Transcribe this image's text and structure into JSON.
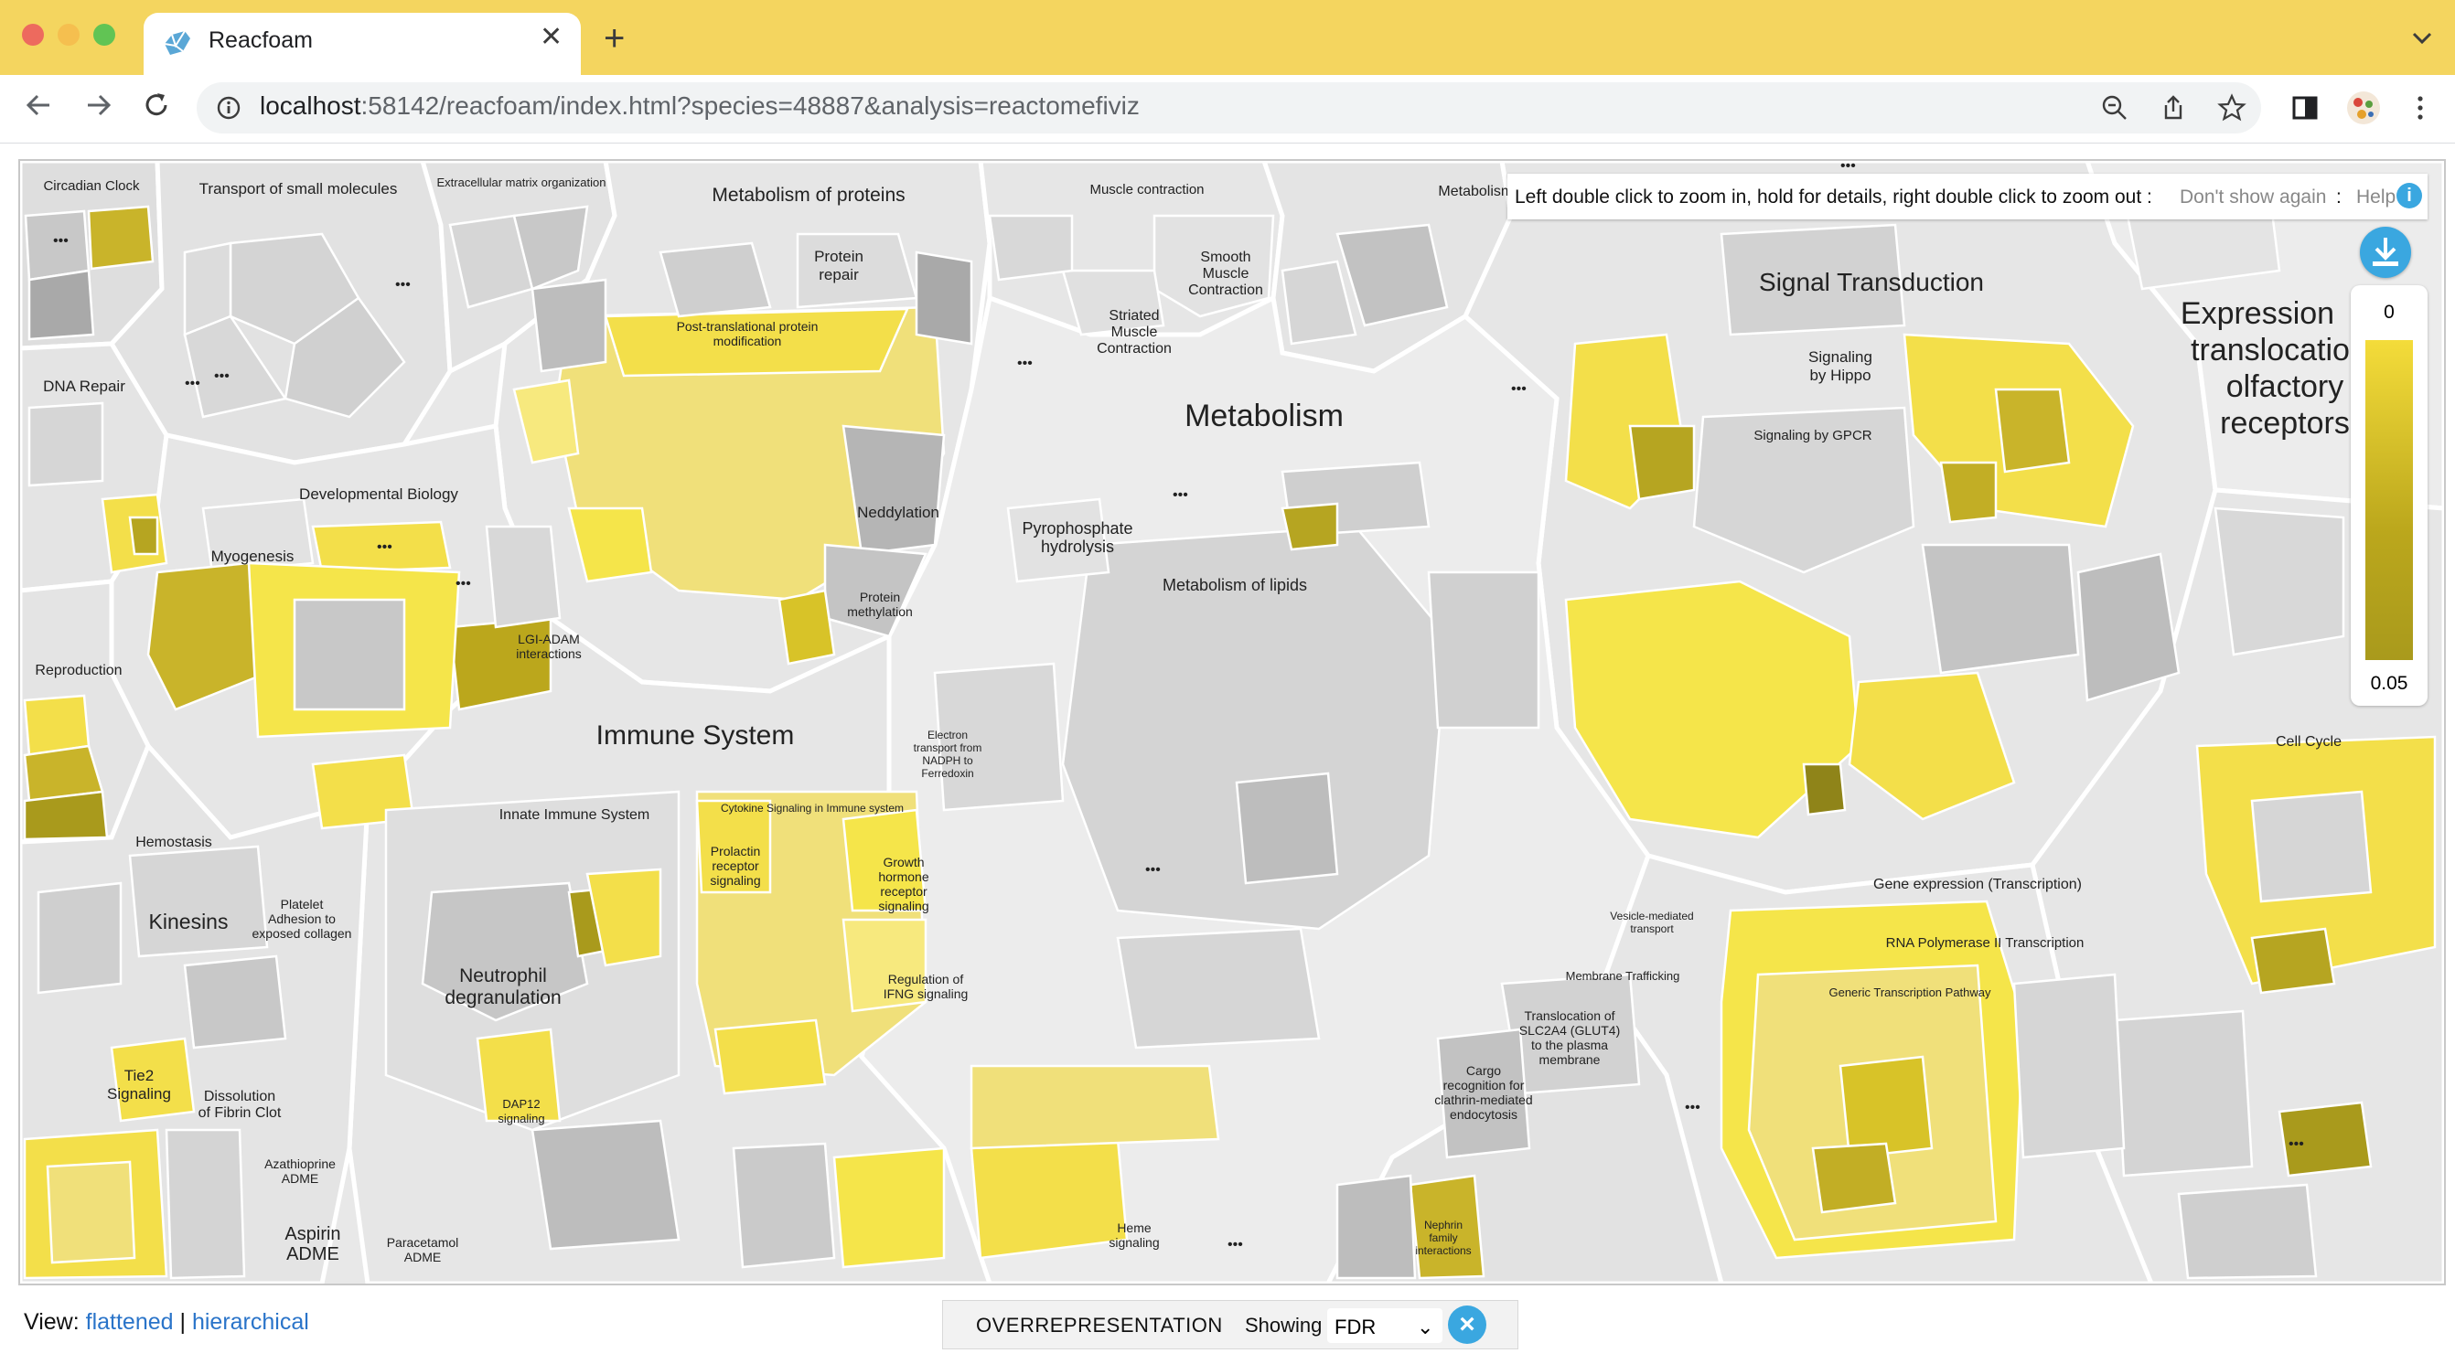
{
  "browser": {
    "tab_title": "Reacfoam",
    "url_host": "localhost",
    "url_rest": ":58142/reacfoam/index.html?species=48887&analysis=reactomefiviz",
    "tab_close": "✕",
    "new_tab": "+",
    "colors": {
      "tabbar": "#f4d55f",
      "omnibox": "#f1f3f4"
    }
  },
  "hint": {
    "text": "Left double click to zoom in, hold for details, right double click to zoom out :",
    "dismiss": "Don't show again",
    "separator": ":",
    "help": "Help",
    "help_icon": "i"
  },
  "legend": {
    "top": "0",
    "bottom": "0.05",
    "colors": [
      "#f4dc3a",
      "#a99a1c"
    ]
  },
  "regions": [
    {
      "name": "Circadian Clock",
      "color": "#e0e0e0"
    },
    {
      "name": "Transport of small molecules",
      "color": "#e0e0e0"
    },
    {
      "name": "Extracellular matrix organization",
      "color": "#e0e0e0"
    },
    {
      "name": "Metabolism of proteins",
      "color": "#e6e6e6"
    },
    {
      "name": "Muscle contraction",
      "color": "#e6e6e6"
    },
    {
      "name": "Metabolism o",
      "color": "#e6e6e6"
    },
    {
      "name": "Signal Transduction",
      "color": "#e6e6e6"
    },
    {
      "name": "Expression and translocation of olfactory receptors",
      "color": "#ececec"
    },
    {
      "name": "DNA Repair",
      "color": "#e6e6e6"
    },
    {
      "name": "Metabolism",
      "color": "#ececec"
    },
    {
      "name": "Developmental Biology",
      "color": "#e6e6e6"
    },
    {
      "name": "Reproduction",
      "color": "#e6e6e6"
    },
    {
      "name": "Immune System",
      "color": "#e6e6e6"
    },
    {
      "name": "Hemostasis",
      "color": "#e6e6e6"
    },
    {
      "name": "Cell Cycle",
      "color": "#e6e6e6"
    },
    {
      "name": "Gene expression (Transcription)",
      "color": "#e6e6e6"
    }
  ],
  "labels": {
    "circadian": "Circadian Clock",
    "transport": "Transport of small molecules",
    "ecm": "Extracellular matrix organization",
    "met_proteins": "Metabolism of proteins",
    "protein_repair_1": "Protein",
    "protein_repair_2": "repair",
    "ptm_1": "Post-translational protein",
    "ptm_2": "modification",
    "neddylation": "Neddylation",
    "protein_methylation_1": "Protein",
    "protein_methylation_2": "methylation",
    "muscle": "Muscle contraction",
    "smooth_1": "Smooth",
    "smooth_2": "Muscle",
    "smooth_3": "Contraction",
    "striated_1": "Striated",
    "striated_2": "Muscle",
    "striated_3": "Contraction",
    "metabolism_o": "Metabolism o",
    "signal": "Signal Transduction",
    "hippo_1": "Signaling",
    "hippo_2": "by Hippo",
    "gpcr": "Signaling by GPCR",
    "olfactory_1": "Expression",
    "olfactory_2": "translocatio",
    "olfactory_3": "olfactory",
    "olfactory_4": "receptors",
    "dna_repair": "DNA Repair",
    "metabolism": "Metabolism",
    "pyro_1": "Pyrophosphate",
    "pyro_2": "hydrolysis",
    "lipids": "Metabolism of lipids",
    "dev_bio": "Developmental Biology",
    "myogenesis": "Myogenesis",
    "lgi_1": "LGI-ADAM",
    "lgi_2": "interactions",
    "reproduction": "Reproduction",
    "immune": "Immune System",
    "innate": "Innate Immune System",
    "cytokine": "Cytokine Signaling in Immune system",
    "neutrophil_1": "Neutrophil",
    "neutrophil_2": "degranulation",
    "hemostasis": "Hemostasis",
    "kinesins": "Kinesins",
    "platelet_1": "Platelet",
    "platelet_2": "Adhesion to",
    "platelet_3": "exposed collagen",
    "tie2_1": "Tie2",
    "tie2_2": "Signaling",
    "dissolution_1": "Dissolution",
    "dissolution_2": "of Fibrin Clot",
    "aspirin_1": "Aspirin",
    "aspirin_2": "ADME",
    "azathioprine_1": "Azathioprine",
    "azathioprine_2": "ADME",
    "paracetamol_1": "Paracetamol",
    "paracetamol_2": "ADME",
    "dap12_1": "DAP12",
    "dap12_2": "signaling",
    "prolactin_1": "Prolactin",
    "prolactin_2": "receptor",
    "prolactin_3": "signaling",
    "growth_1": "Growth",
    "growth_2": "hormone",
    "growth_3": "receptor",
    "growth_4": "signaling",
    "ifng_1": "Regulation of",
    "ifng_2": "IFNG signaling",
    "heme_1": "Heme",
    "heme_2": "signaling",
    "electron_1": "Electron",
    "electron_2": "transport from",
    "electron_3": "NADPH to",
    "electron_4": "Ferredoxin",
    "cell_cycle": "Cell Cycle",
    "gene_expr": "Gene expression (Transcription)",
    "rna_pol": "RNA Polymerase II Transcription",
    "generic_tx": "Generic Transcription Pathway",
    "membrane": "Membrane Trafficking",
    "vesicle_1": "Vesicle-mediated",
    "vesicle_2": "transport",
    "glut4_1": "Translocation of",
    "glut4_2": "SLC2A4 (GLUT4)",
    "glut4_3": "to the plasma",
    "glut4_4": "membrane",
    "cargo_1": "Cargo",
    "cargo_2": "recognition for",
    "cargo_3": "clathrin-mediated",
    "cargo_4": "endocytosis",
    "nephrin_1": "Nephrin",
    "nephrin_2": "family",
    "nephrin_3": "interactions"
  },
  "footer": {
    "view_label": "View:",
    "flattened": "flattened",
    "divider": "|",
    "hierarchical": "hierarchical",
    "analysis_type": "OVERREPRESENTATION",
    "showing": "Showing",
    "metric": "FDR",
    "metric_caret": "⌄",
    "clear": "×"
  }
}
